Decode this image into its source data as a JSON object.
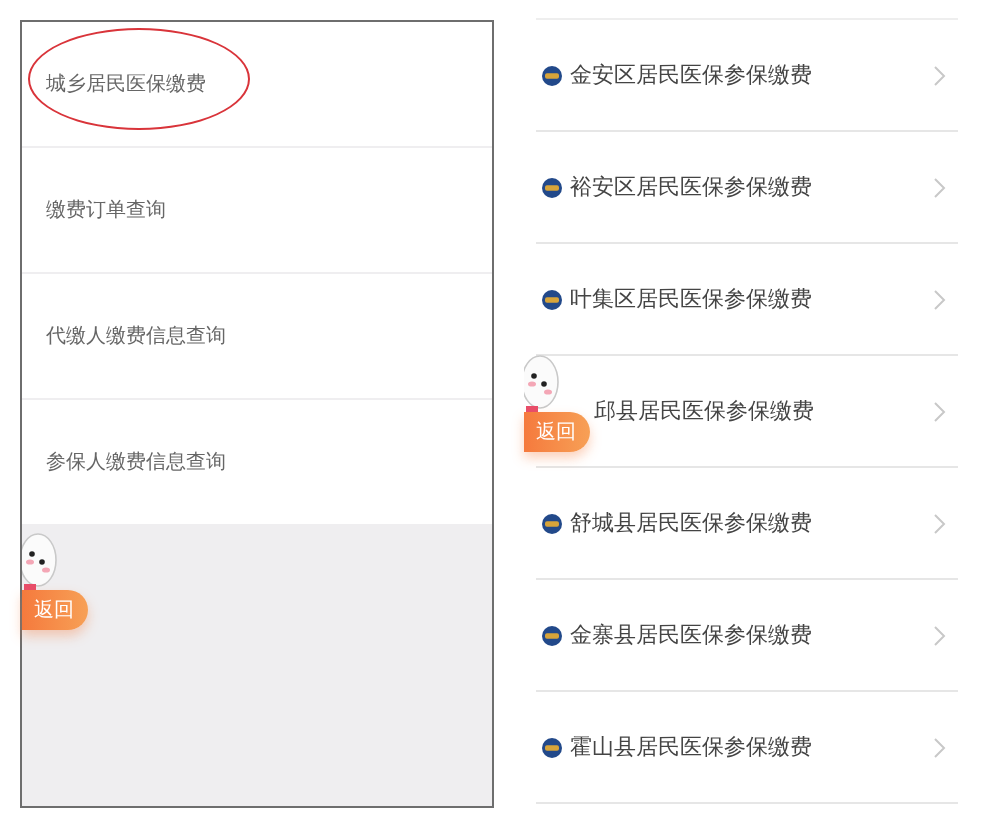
{
  "left_screen": {
    "items": [
      {
        "label": "城乡居民医保缴费",
        "circled": true
      },
      {
        "label": "缴费订单查询",
        "circled": false
      },
      {
        "label": "代缴人缴费信息查询",
        "circled": false
      },
      {
        "label": "参保人缴费信息查询",
        "circled": false
      }
    ],
    "back_button": {
      "label": "返回"
    }
  },
  "right_screen": {
    "items": [
      {
        "label": "金安区居民医保参保缴费",
        "kind": "logo"
      },
      {
        "label": "裕安区居民医保参保缴费",
        "kind": "logo"
      },
      {
        "label": "叶集区居民医保参保缴费",
        "kind": "logo"
      },
      {
        "label": "邱县居民医保参保缴费",
        "kind": "covered"
      },
      {
        "label": "舒城县居民医保参保缴费",
        "kind": "logo"
      },
      {
        "label": "金寨县居民医保参保缴费",
        "kind": "logo"
      },
      {
        "label": "霍山县居民医保参保缴费",
        "kind": "logo"
      }
    ],
    "back_button": {
      "label": "返回"
    }
  }
}
